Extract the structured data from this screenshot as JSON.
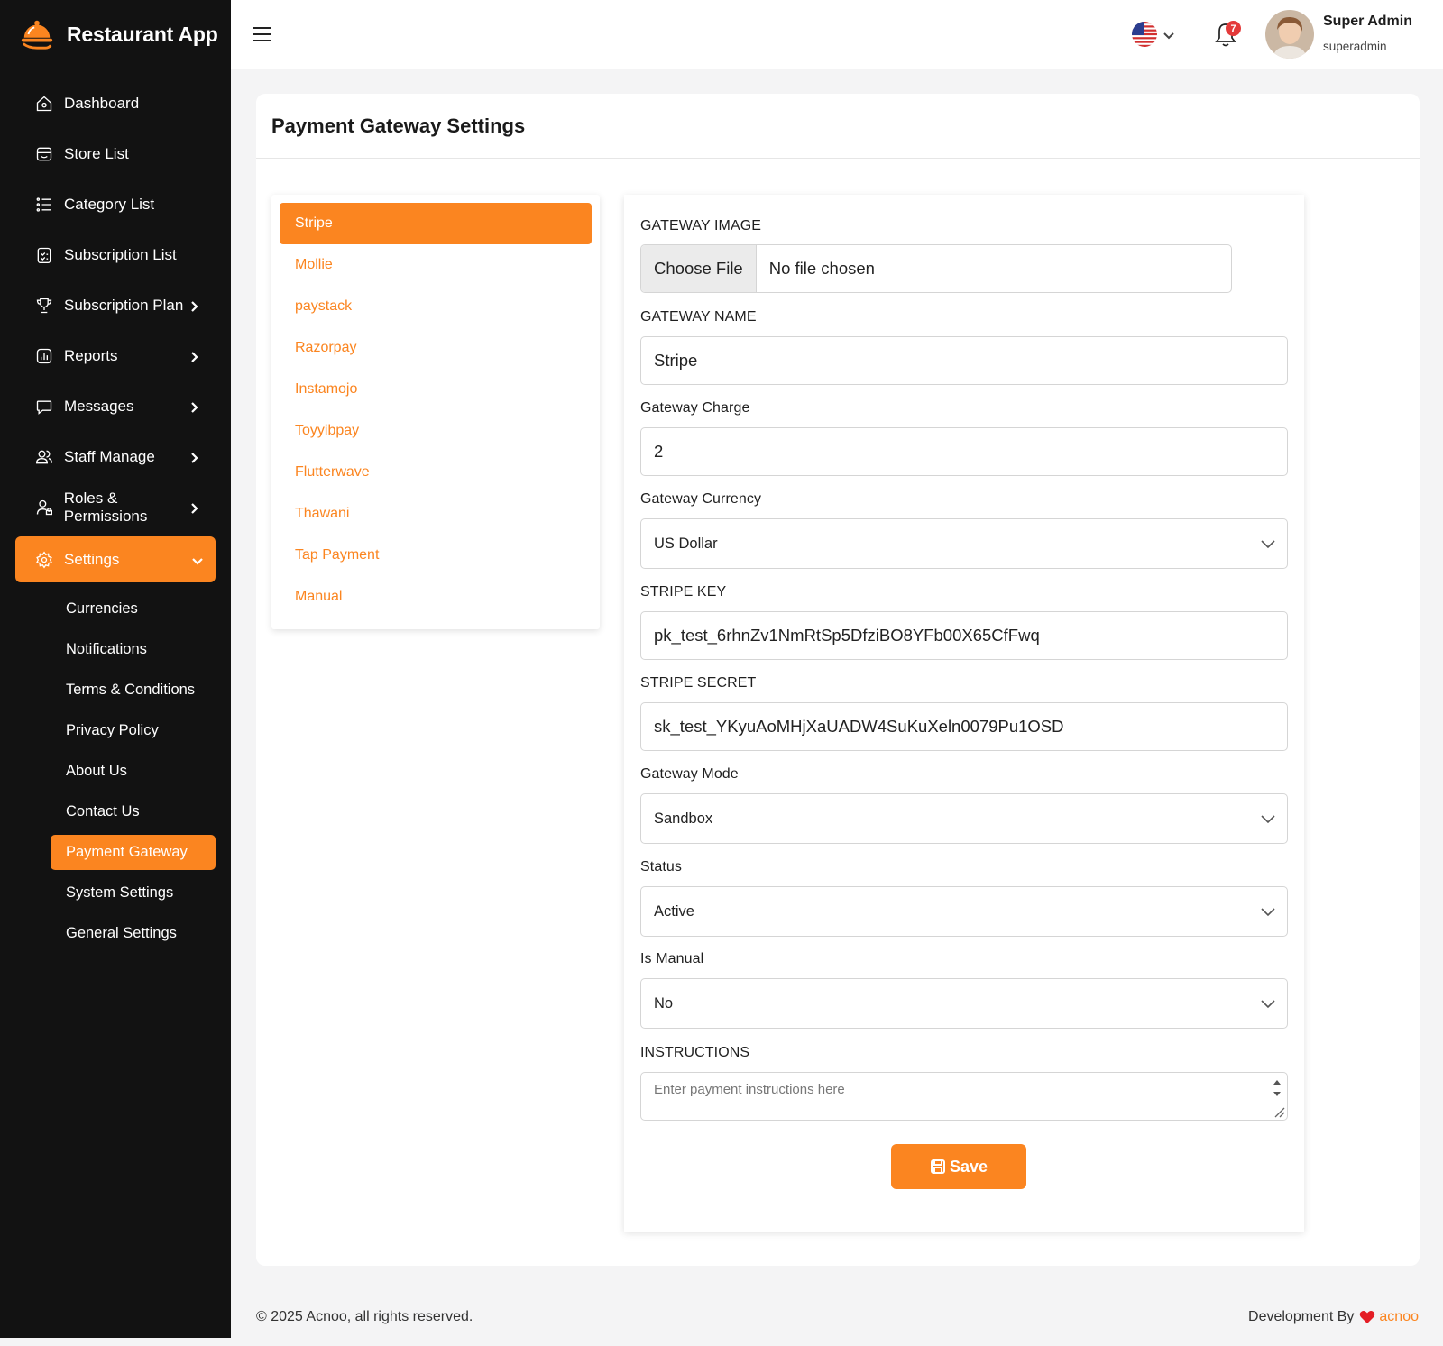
{
  "app": {
    "name": "Restaurant App"
  },
  "sidebar": {
    "items": [
      {
        "label": "Dashboard"
      },
      {
        "label": "Store List"
      },
      {
        "label": "Category List"
      },
      {
        "label": "Subscription List"
      },
      {
        "label": "Subscription Plan"
      },
      {
        "label": "Reports"
      },
      {
        "label": "Messages"
      },
      {
        "label": "Staff Manage"
      },
      {
        "label": "Roles & Permissions"
      },
      {
        "label": "Settings"
      }
    ],
    "settings_sub": [
      {
        "label": "Currencies"
      },
      {
        "label": "Notifications"
      },
      {
        "label": "Terms & Conditions"
      },
      {
        "label": "Privacy Policy"
      },
      {
        "label": "About Us"
      },
      {
        "label": "Contact Us"
      },
      {
        "label": "Payment Gateway"
      },
      {
        "label": "System Settings"
      },
      {
        "label": "General Settings"
      }
    ]
  },
  "header": {
    "notification_count": "7",
    "user": {
      "name": "Super Admin",
      "role": "superadmin"
    },
    "language_icon": "us-flag-icon"
  },
  "page": {
    "title": "Payment Gateway Settings"
  },
  "gateways": [
    {
      "label": "Stripe"
    },
    {
      "label": "Mollie"
    },
    {
      "label": "paystack"
    },
    {
      "label": "Razorpay"
    },
    {
      "label": "Instamojo"
    },
    {
      "label": "Toyyibpay"
    },
    {
      "label": "Flutterwave"
    },
    {
      "label": "Thawani"
    },
    {
      "label": "Tap Payment"
    },
    {
      "label": "Manual"
    }
  ],
  "form": {
    "gateway_image": {
      "label": "GATEWAY IMAGE",
      "button": "Choose File",
      "status": "No file chosen"
    },
    "gateway_name": {
      "label": "GATEWAY NAME",
      "value": "Stripe"
    },
    "gateway_charge": {
      "label": "Gateway Charge",
      "value": "2"
    },
    "gateway_currency": {
      "label": "Gateway Currency",
      "value": "US Dollar"
    },
    "stripe_key": {
      "label": "STRIPE KEY",
      "value": "pk_test_6rhnZv1NmRtSp5DfziBO8YFb00X65CfFwq"
    },
    "stripe_secret": {
      "label": "STRIPE SECRET",
      "value": "sk_test_YKyuAoMHjXaUADW4SuKuXeln0079Pu1OSD"
    },
    "gateway_mode": {
      "label": "Gateway Mode",
      "value": "Sandbox"
    },
    "status": {
      "label": "Status",
      "value": "Active"
    },
    "is_manual": {
      "label": "Is Manual",
      "value": "No"
    },
    "instructions": {
      "label": "INSTRUCTIONS",
      "placeholder": "Enter payment instructions here"
    },
    "save_label": "Save"
  },
  "footer": {
    "copyright": "© 2025 Acnoo, all rights reserved.",
    "dev_prefix": "Development By",
    "dev_brand": "acnoo"
  },
  "colors": {
    "accent": "#fb8520",
    "sidebar_bg": "#121212",
    "badge": "#e43a3a"
  }
}
